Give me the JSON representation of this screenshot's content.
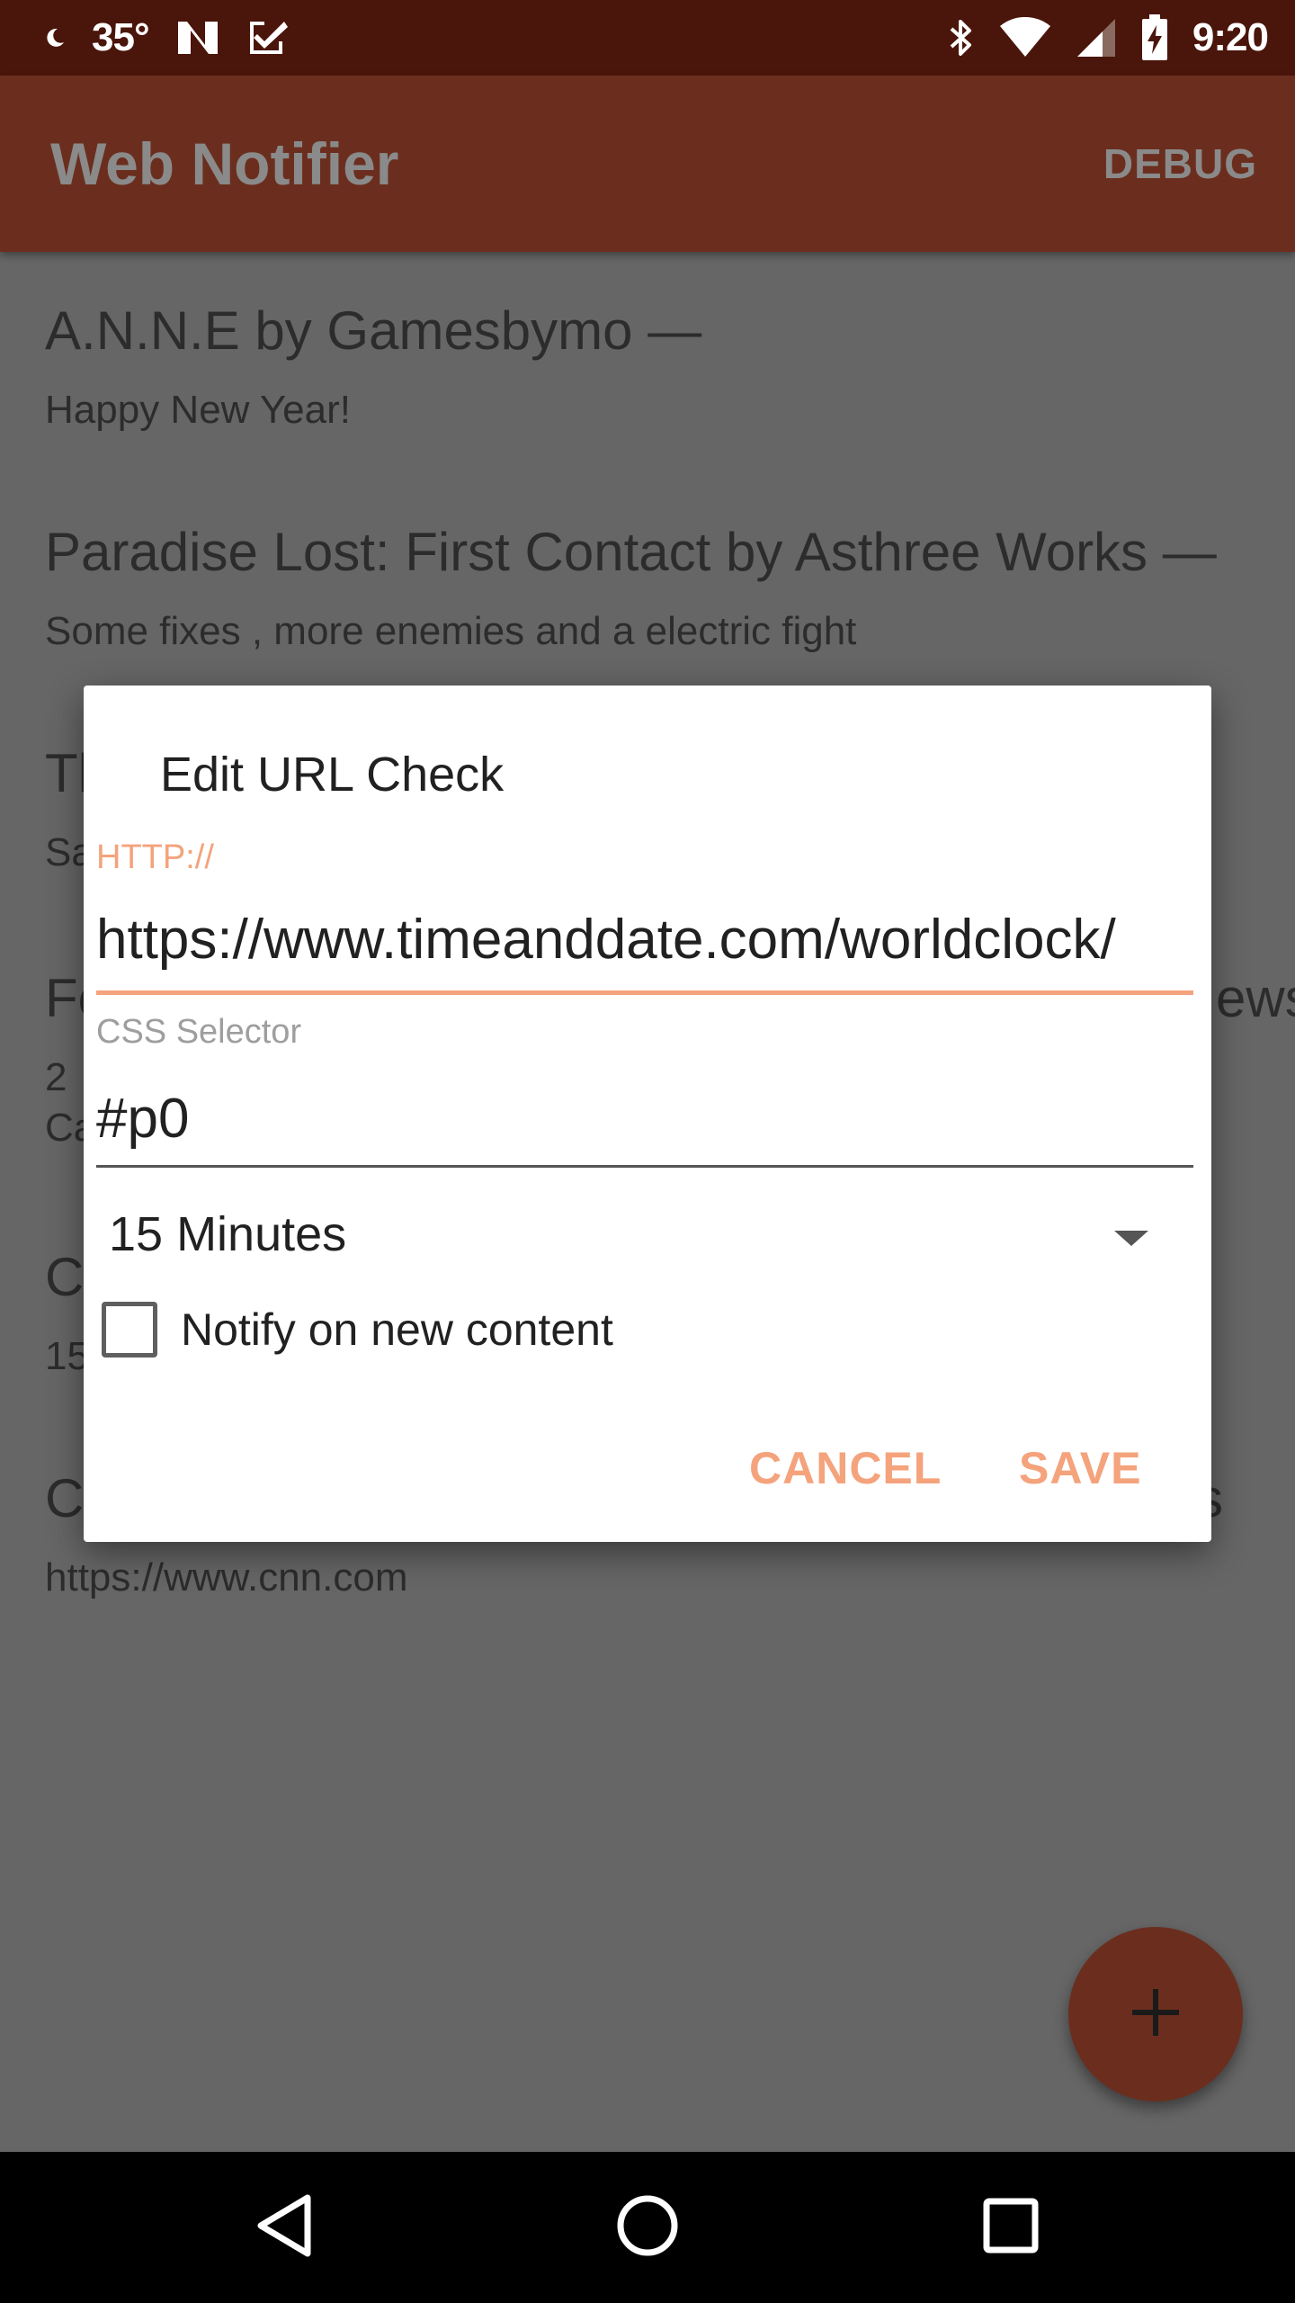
{
  "status_bar": {
    "temperature": "35°",
    "time": "9:20"
  },
  "app_bar": {
    "title": "Web Notifier",
    "debug_label": "DEBUG"
  },
  "list": {
    "items": [
      {
        "title": "A.N.N.E by Gamesbymo —",
        "subtitle": "Happy New Year!"
      },
      {
        "title": "Paradise Lost: First Contact by Asthree Works —",
        "subtitle": "Some fixes , more enemies and a electric fight"
      },
      {
        "title": "Th",
        "subtitle": "Sa"
      },
      {
        "title": "Fo",
        "title_tail": "ews",
        "subtitle": "2",
        "subtitle2": "Ca"
      },
      {
        "title": "C",
        "subtitle": "15"
      },
      {
        "title": "C",
        "title_tail": "s",
        "subtitle": "https://www.cnn.com"
      }
    ]
  },
  "dialog": {
    "title": "Edit URL Check",
    "url_label": "HTTP://",
    "url_value": "https://www.timeanddate.com/worldclock/",
    "css_label": "CSS Selector",
    "css_value": "#p0",
    "interval_value": "15 Minutes",
    "notify_label": "Notify on new content",
    "notify_checked": false,
    "cancel_label": "CANCEL",
    "save_label": "SAVE"
  },
  "colors": {
    "accent": "#f4a37c",
    "app_bar_bg": "#6b2e1e",
    "status_bar_bg": "#4a150a"
  },
  "icons": {
    "fab": "plus-icon",
    "nav_back": "back-triangle-icon",
    "nav_home": "home-circle-icon",
    "nav_recents": "recents-square-icon"
  }
}
